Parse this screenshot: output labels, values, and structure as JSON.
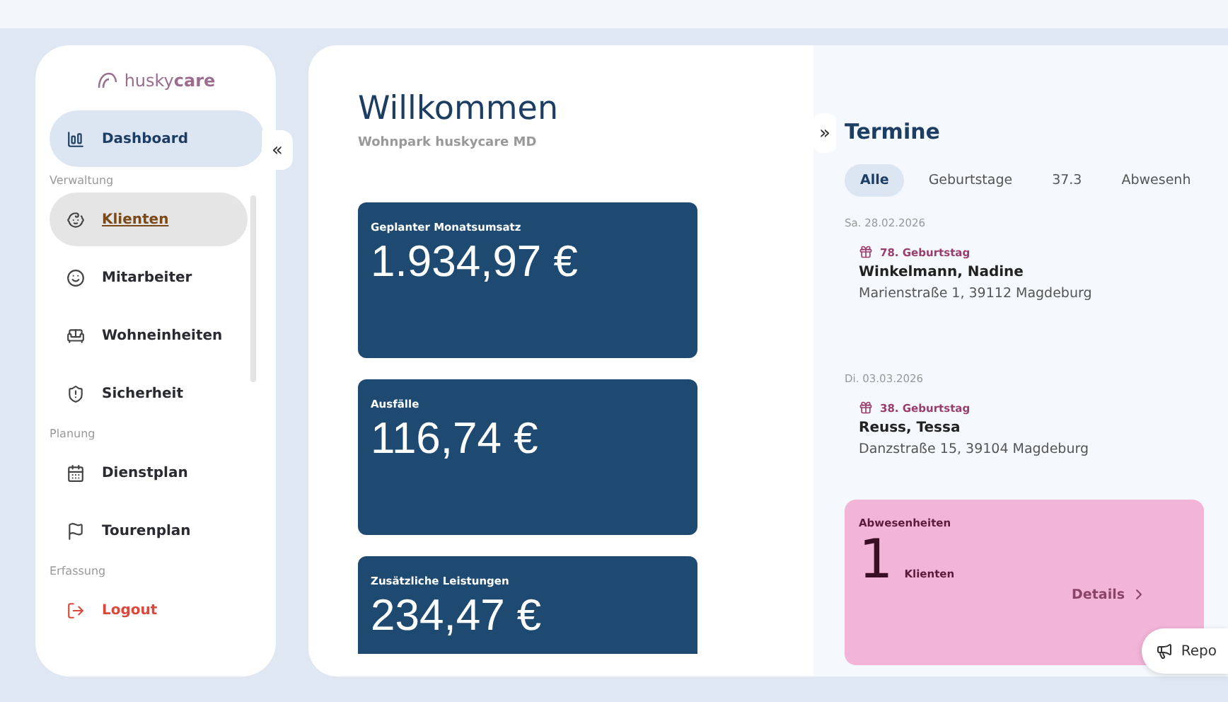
{
  "sidebar": {
    "logo": {
      "part1": "husky",
      "part2": "care"
    },
    "items": [
      {
        "kind": "link",
        "label": "Dashboard",
        "selected": true,
        "hovered": false
      },
      {
        "kind": "section",
        "label": "Verwaltung"
      },
      {
        "kind": "link",
        "label": "Klienten",
        "selected": false,
        "hovered": true
      },
      {
        "kind": "link",
        "label": "Mitarbeiter",
        "selected": false,
        "hovered": false
      },
      {
        "kind": "link",
        "label": "Wohneinheiten",
        "selected": false,
        "hovered": false
      },
      {
        "kind": "link",
        "label": "Sicherheit",
        "selected": false,
        "hovered": false
      },
      {
        "kind": "section",
        "label": "Planung"
      },
      {
        "kind": "link",
        "label": "Dienstplan",
        "selected": false,
        "hovered": false
      },
      {
        "kind": "link",
        "label": "Tourenplan",
        "selected": false,
        "hovered": false
      },
      {
        "kind": "section",
        "label": "Erfassung"
      },
      {
        "kind": "logout",
        "label": "Logout",
        "selected": false,
        "hovered": false
      }
    ],
    "collapse": "«"
  },
  "main": {
    "title": "Willkommen",
    "subtitle": "Wohnpark huskycare MD",
    "cards": [
      {
        "label": "Geplanter Monatsumsatz",
        "value": "1.934,97 €"
      },
      {
        "label": "Ausfälle",
        "value": "116,74 €"
      },
      {
        "label": "Zusätzliche Leistungen",
        "value": "234,47 €"
      }
    ]
  },
  "panel": {
    "expand": "»",
    "title": "Termine",
    "tabs": [
      {
        "label": "Alle",
        "selected": true
      },
      {
        "label": "Geburtstage",
        "selected": false
      },
      {
        "label": "37.3",
        "selected": false
      },
      {
        "label": "Abwesenh",
        "selected": false
      }
    ],
    "events": [
      {
        "date": "Sa. 28.02.2026",
        "tag": "78. Geburtstag",
        "name": "Winkelmann, Nadine",
        "address": "Marienstraße 1, 39112 Magdeburg"
      },
      {
        "date": "Di. 03.03.2026",
        "tag": "38. Geburtstag",
        "name": "Reuss, Tessa",
        "address": "Danzstraße 15, 39104 Magdeburg"
      }
    ],
    "absence": {
      "title": "Abwesenheiten",
      "count": "1",
      "unit": "Klienten",
      "link": "Details"
    },
    "report": "Repo"
  }
}
